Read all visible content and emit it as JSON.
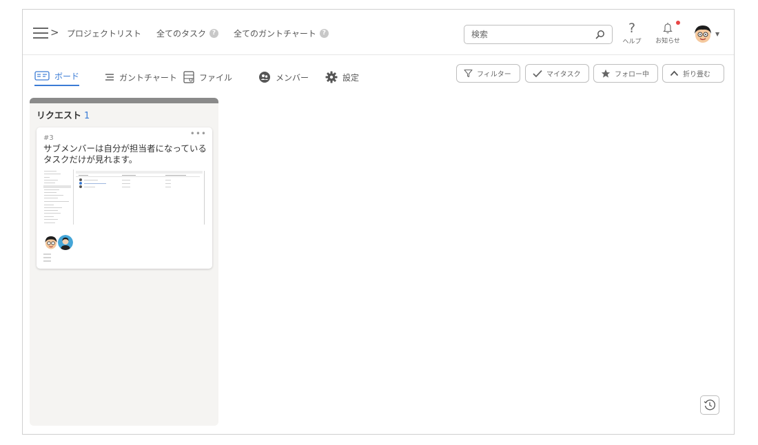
{
  "header": {
    "nav": [
      {
        "label": "プロジェクトリスト",
        "help": false
      },
      {
        "label": "全てのタスク",
        "help": true
      },
      {
        "label": "全てのガントチャート",
        "help": true
      }
    ],
    "help_glyph": "?",
    "search_placeholder": "検索",
    "help_label": "ヘルプ",
    "notify_label": "お知らせ",
    "has_unread": true,
    "icons": {
      "menu": "hamburger-icon",
      "search": "search-icon",
      "help": "question-icon",
      "notify": "bell-icon",
      "avatar": "user-avatar-icon",
      "caret": "caret-down-icon"
    }
  },
  "tabs": [
    {
      "label": "ボード",
      "icon": "kanban-board-icon",
      "active": true
    },
    {
      "label": "ガントチャート",
      "icon": "gantt-icon",
      "active": false
    },
    {
      "label": "ファイル",
      "icon": "file-icon",
      "active": false
    },
    {
      "label": "メンバー",
      "icon": "members-icon",
      "active": false
    },
    {
      "label": "設定",
      "icon": "gear-icon",
      "active": false
    }
  ],
  "toolbar": {
    "filter_label": "フィルター",
    "mytask_label": "マイタスク",
    "follow_label": "フォロー中",
    "fold_label": "折り畳む"
  },
  "board": {
    "column": {
      "title": "リクエスト",
      "count": "1",
      "card": {
        "id": "#3",
        "title": "サブメンバーは自分が担当者になっているタスクだけが見れます。",
        "assignees": [
          "assignee-avatar-1",
          "assignee-avatar-2"
        ]
      }
    }
  },
  "colors": {
    "accent": "#3a7bd5",
    "notification_dot": "#e84545",
    "column_bg": "#f5f4f2",
    "column_bar": "#8a8a8a"
  }
}
